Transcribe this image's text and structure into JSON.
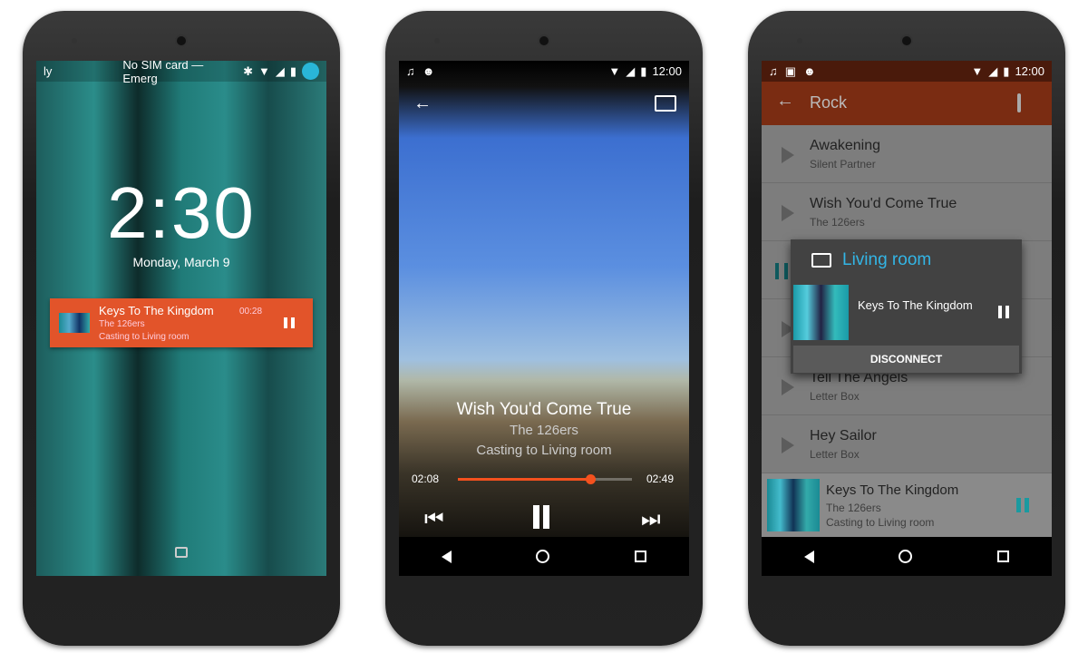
{
  "lockscreen": {
    "status_left": "ly",
    "carrier": "No SIM card — Emerg",
    "time": "2:30",
    "date": "Monday, March 9",
    "notification": {
      "title": "Keys To The Kingdom",
      "artist": "The 126ers",
      "status": "Casting to Living room",
      "elapsed": "00:28"
    }
  },
  "player": {
    "clock": "12:00",
    "title": "Wish You'd Come True",
    "artist": "The 126ers",
    "status": "Casting to Living room",
    "elapsed": "02:08",
    "duration": "02:49",
    "progress": 0.76
  },
  "list": {
    "clock": "12:00",
    "toolbar_title": "Rock",
    "items": [
      {
        "title": "Awakening",
        "artist": "Silent Partner"
      },
      {
        "title": "Wish You'd Come True",
        "artist": "The 126ers"
      },
      {
        "title": "",
        "artist": ""
      },
      {
        "title": "",
        "artist": ""
      },
      {
        "title": "Tell The Angels",
        "artist": "Letter Box"
      },
      {
        "title": "Hey Sailor",
        "artist": "Letter Box"
      }
    ],
    "dialog": {
      "device": "Living room",
      "track": "Keys To The Kingdom",
      "disconnect": "DISCONNECT"
    },
    "mini_player": {
      "title": "Keys To The Kingdom",
      "artist": "The 126ers",
      "status": "Casting to Living room"
    }
  },
  "colors": {
    "accent": "#e5552a",
    "cast_blue": "#33b5e5",
    "teal": "#1a9aa0"
  }
}
